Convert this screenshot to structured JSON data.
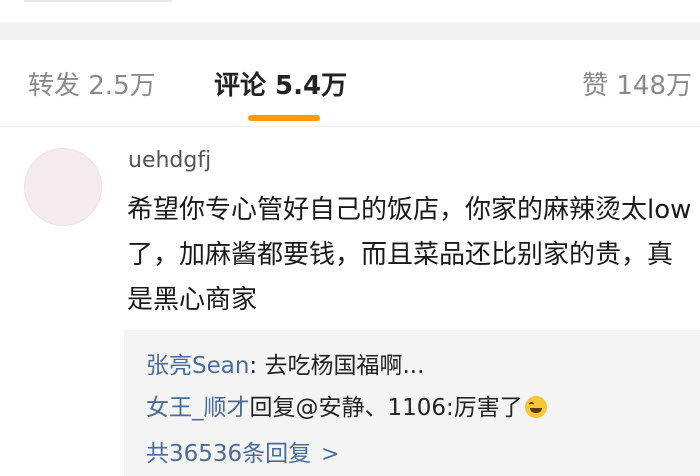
{
  "tabs": {
    "repost": "转发 2.5万",
    "comments": "评论 5.4万",
    "likes": "赞 148万",
    "active": "comments"
  },
  "comment": {
    "username": "uehdgfj",
    "text": "希望你专心管好自己的饭店，你家的麻辣烫太low了，加麻酱都要钱，而且菜品还比别家的贵，真是黑心商家"
  },
  "replies": [
    {
      "name": "张亮Sean",
      "text": ": 去吃杨国福啊..."
    },
    {
      "name": "女王_顺才",
      "text": "回复@安静、1106:厉害了",
      "emoji": "laughing-tears-emoji"
    }
  ],
  "more_replies": "共36536条回复",
  "colors": {
    "accent": "#ff9a00",
    "link": "#4a6c97"
  }
}
